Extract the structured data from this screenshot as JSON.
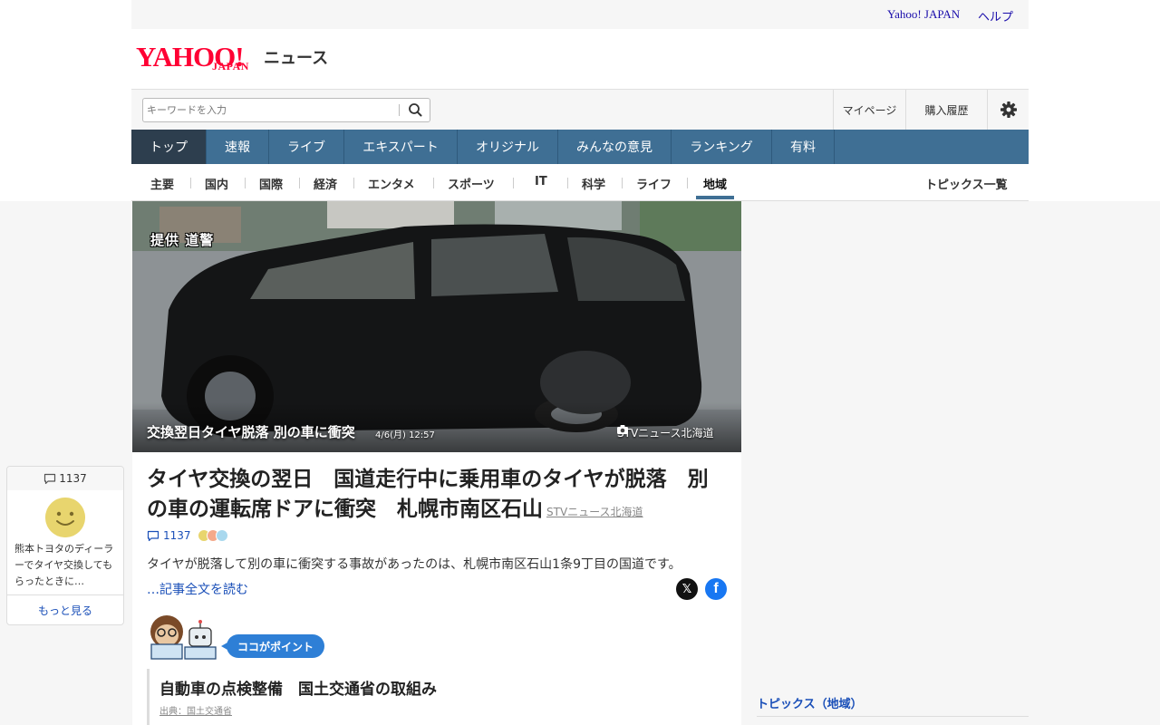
{
  "header": {
    "utility_links": [
      "Yahoo! JAPAN",
      "ヘルプ"
    ],
    "logo_main": "YAHOO!",
    "logo_sub": "JAPAN",
    "logo_news": "ニュース"
  },
  "search": {
    "placeholder": "キーワードを入力",
    "mypage": "マイページ",
    "history": "購入履歴"
  },
  "main_nav": [
    "トップ",
    "速報",
    "ライブ",
    "エキスパート",
    "オリジナル",
    "みんなの意見",
    "ランキング",
    "有料"
  ],
  "sub_nav": {
    "items": [
      "主要",
      "国内",
      "国際",
      "経済",
      "エンタメ",
      "スポーツ",
      "IT",
      "科学",
      "ライフ",
      "地域"
    ],
    "topics_all": "トピックス一覧"
  },
  "hero": {
    "watermark": "提供 道警",
    "caption": "交換翌日タイヤ脱落 別の車に衝突",
    "date": "4/6(月) 12:57",
    "credit": "STVニュース北海道"
  },
  "article": {
    "title": "タイヤ交換の翌日　国道走行中に乗用車のタイヤが脱落　別の車の運転席ドアに衝突　札幌市南区石山",
    "source": "STVニュース北海道",
    "comment_count": "1137",
    "lead": "タイヤが脱落して別の車に衝突する事故があったのは、札幌市南区石山1条9丁目の国道です。",
    "read_more": "…記事全文を読む",
    "point_badge": "ココがポイント",
    "point_title": "自動車の点検整備　国土交通省の取組み",
    "point_source": "出典：国土交通省"
  },
  "right": {
    "topics_title": "トピックス（地域）"
  },
  "comment_card": {
    "count": "1137",
    "text": "熊本トヨタのディーラーでタイヤ交換してもらったときに…",
    "more": "もっと見る"
  },
  "colors": {
    "nav_bg": "#3f6f94",
    "nav_active": "#2d3e4e",
    "link": "#1a4fb8",
    "yahoo_red": "#ff0033",
    "badge": "#2e7fd6"
  }
}
